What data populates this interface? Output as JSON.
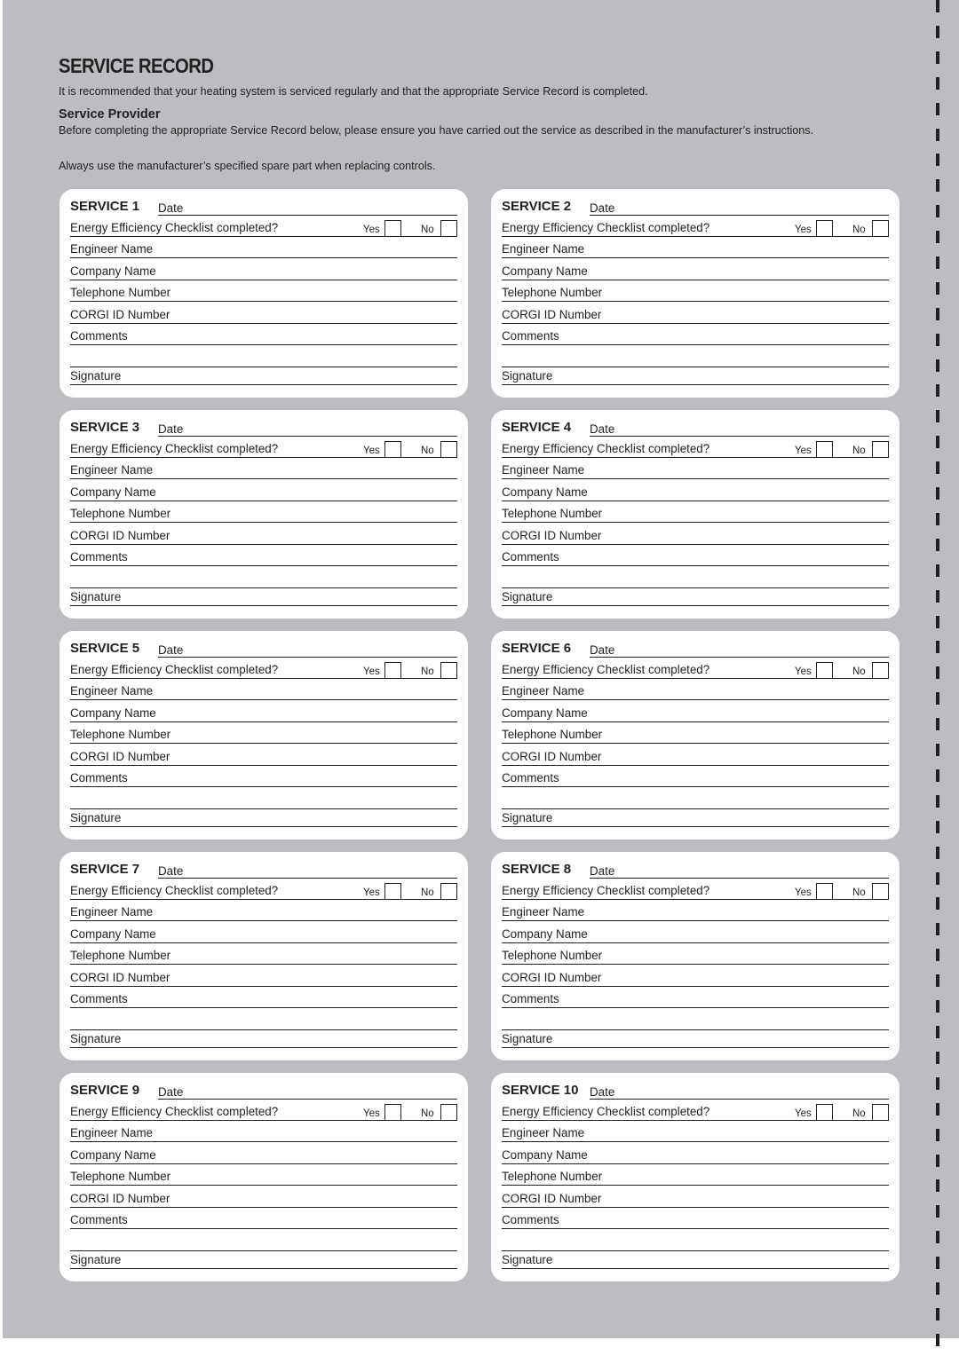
{
  "document": {
    "title": "SERVICE RECORD",
    "intro": "It is recommended that your heating system is serviced regularly and that the appropriate Service Record is completed.",
    "service_provider": {
      "heading": "Service Provider",
      "body": "Before completing the appropriate Service Record below, please ensure you have carried out the service as described in the manufacturer’s instructions.",
      "note": "Always use the manufacturer’s specified spare part when replacing controls."
    }
  },
  "colors": {
    "page_background": "#bcbdc0",
    "card_background": "#ffffff",
    "ink": "#231f20"
  },
  "cards": [
    {
      "title": "SERVICE 1",
      "date_label": "Date",
      "checklist_label": "Energy Efficiency Checklist completed?",
      "yes_label": "Yes",
      "no_label": "No",
      "engineer_label": "Engineer Name",
      "company_label": "Company Name",
      "telephone_label": "Telephone Number",
      "corgi_label": "CORGI ID Number",
      "comments_label": "Comments",
      "signature_label": "Signature"
    },
    {
      "title": "SERVICE 2",
      "date_label": "Date",
      "checklist_label": "Energy Efficiency Checklist completed?",
      "yes_label": "Yes",
      "no_label": "No",
      "engineer_label": "Engineer Name",
      "company_label": "Company Name",
      "telephone_label": "Telephone Number",
      "corgi_label": "CORGI ID Number",
      "comments_label": "Comments",
      "signature_label": "Signature"
    },
    {
      "title": "SERVICE 3",
      "date_label": "Date",
      "checklist_label": "Energy Efficiency Checklist completed?",
      "yes_label": "Yes",
      "no_label": "No",
      "engineer_label": "Engineer Name",
      "company_label": "Company Name",
      "telephone_label": "Telephone Number",
      "corgi_label": "CORGI ID Number",
      "comments_label": "Comments",
      "signature_label": "Signature"
    },
    {
      "title": "SERVICE 4",
      "date_label": "Date",
      "checklist_label": "Energy Efficiency Checklist completed?",
      "yes_label": "Yes",
      "no_label": "No",
      "engineer_label": "Engineer Name",
      "company_label": "Company Name",
      "telephone_label": "Telephone Number",
      "corgi_label": "CORGI ID Number",
      "comments_label": "Comments",
      "signature_label": "Signature"
    },
    {
      "title": "SERVICE 5",
      "date_label": "Date",
      "checklist_label": "Energy Efficiency Checklist completed?",
      "yes_label": "Yes",
      "no_label": "No",
      "engineer_label": "Engineer Name",
      "company_label": "Company Name",
      "telephone_label": "Telephone Number",
      "corgi_label": "CORGI ID Number",
      "comments_label": "Comments",
      "signature_label": "Signature"
    },
    {
      "title": "SERVICE 6",
      "date_label": "Date",
      "checklist_label": "Energy Efficiency Checklist completed?",
      "yes_label": "Yes",
      "no_label": "No",
      "engineer_label": "Engineer Name",
      "company_label": "Company Name",
      "telephone_label": "Telephone Number",
      "corgi_label": "CORGI ID Number",
      "comments_label": "Comments",
      "signature_label": "Signature"
    },
    {
      "title": "SERVICE 7",
      "date_label": "Date",
      "checklist_label": "Energy Efficiency Checklist completed?",
      "yes_label": "Yes",
      "no_label": "No",
      "engineer_label": "Engineer Name",
      "company_label": "Company Name",
      "telephone_label": "Telephone Number",
      "corgi_label": "CORGI ID Number",
      "comments_label": "Comments",
      "signature_label": "Signature"
    },
    {
      "title": "SERVICE 8",
      "date_label": "Date",
      "checklist_label": "Energy Efficiency Checklist completed?",
      "yes_label": "Yes",
      "no_label": "No",
      "engineer_label": "Engineer Name",
      "company_label": "Company Name",
      "telephone_label": "Telephone Number",
      "corgi_label": "CORGI ID Number",
      "comments_label": "Comments",
      "signature_label": "Signature"
    },
    {
      "title": "SERVICE 9",
      "date_label": "Date",
      "checklist_label": "Energy Efficiency Checklist completed?",
      "yes_label": "Yes",
      "no_label": "No",
      "engineer_label": "Engineer Name",
      "company_label": "Company Name",
      "telephone_label": "Telephone Number",
      "corgi_label": "CORGI ID Number",
      "comments_label": "Comments",
      "signature_label": "Signature"
    },
    {
      "title": "SERVICE 10",
      "date_label": "Date",
      "checklist_label": "Energy Efficiency Checklist completed?",
      "yes_label": "Yes",
      "no_label": "No",
      "engineer_label": "Engineer Name",
      "company_label": "Company Name",
      "telephone_label": "Telephone Number",
      "corgi_label": "CORGI ID  Number",
      "comments_label": "Comments",
      "signature_label": "Signature"
    }
  ]
}
